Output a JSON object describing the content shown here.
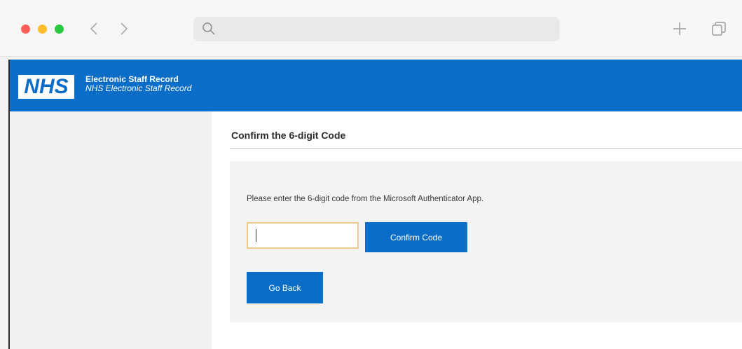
{
  "browser": {
    "address_value": "",
    "icons": {
      "back": "chevron-left-icon",
      "forward": "chevron-right-icon",
      "search": "search-icon",
      "new_tab": "plus-icon",
      "tabs_overview": "tabs-icon"
    }
  },
  "header": {
    "logo_text": "NHS",
    "title": "Electronic Staff Record",
    "subtitle": "NHS Electronic Staff Record",
    "background_color": "#0a6ec8"
  },
  "main": {
    "heading": "Confirm the 6-digit Code",
    "instruction": "Please enter the 6-digit code from the Microsoft Authenticator App.",
    "code_input_value": "",
    "confirm_button": "Confirm Code",
    "back_button": "Go Back"
  }
}
